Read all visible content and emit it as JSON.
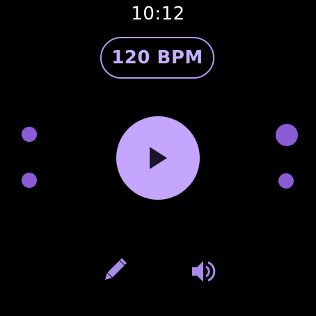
{
  "status": {
    "time": "10:12"
  },
  "metronome": {
    "bpm_label": "120 BPM",
    "state": "paused"
  },
  "icons": {
    "play": "play-icon",
    "edit": "pencil-icon",
    "volume": "volume-icon"
  },
  "colors": {
    "background": "#000000",
    "accent": "#c4a5ff",
    "accent_dark": "#8a5cd6",
    "chip_border": "#b49aef",
    "text": "#ffffff"
  }
}
